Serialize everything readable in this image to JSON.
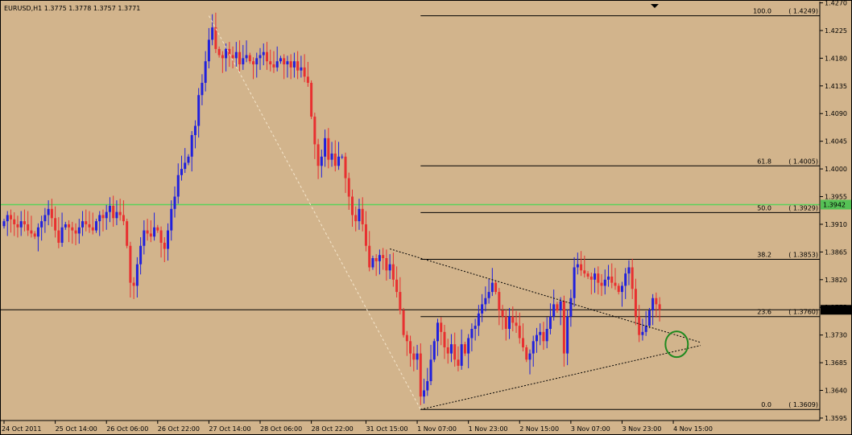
{
  "symbol_header": "EURUSD,H1  1.3775 1.3778 1.3757 1.3771",
  "colors": {
    "background": "#d2b48c",
    "bull": "#2020dd",
    "bear": "#e83030",
    "horizontal_line": "#5ad25a",
    "axis": "#000000",
    "circle": "#1f8a1f",
    "price_tag": "#000000",
    "green_tag": "#55c155"
  },
  "chart_data": {
    "type": "candlestick",
    "instrument": "EURUSD",
    "timeframe": "H1",
    "ohlc_last": {
      "open": 1.3775,
      "high": 1.3778,
      "low": 1.3757,
      "close": 1.3771
    },
    "ylim": [
      1.3591,
      1.4272
    ],
    "y_ticks": [
      "1.4270",
      "1.4225",
      "1.4180",
      "1.4135",
      "1.4090",
      "1.4045",
      "1.4000",
      "1.3955",
      "1.3910",
      "1.3865",
      "1.3820",
      "1.3775",
      "1.3730",
      "1.3685",
      "1.3640",
      "1.3595"
    ],
    "x_labels": [
      "24 Oct 2011",
      "25 Oct 14:00",
      "26 Oct 06:00",
      "26 Oct 22:00",
      "27 Oct 14:00",
      "28 Oct 06:00",
      "28 Oct 22:00",
      "31 Oct 15:00",
      "1 Nov 07:00",
      "1 Nov 23:00",
      "2 Nov 15:00",
      "3 Nov 07:00",
      "3 Nov 23:00",
      "4 Nov 15:00"
    ],
    "x_label_index": [
      0,
      15,
      30,
      45,
      60,
      75,
      90,
      106,
      121,
      136,
      151,
      166,
      181,
      196
    ],
    "bar_count": 205,
    "closes": [
      1.3915,
      1.3925,
      1.3918,
      1.391,
      1.3905,
      1.3915,
      1.391,
      1.39,
      1.3895,
      1.389,
      1.3905,
      1.3915,
      1.3925,
      1.3935,
      1.392,
      1.39,
      1.388,
      1.3905,
      1.391,
      1.3905,
      1.39,
      1.3895,
      1.3905,
      1.3915,
      1.391,
      1.3905,
      1.39,
      1.3915,
      1.3925,
      1.392,
      1.393,
      1.394,
      1.392,
      1.393,
      1.3925,
      1.3915,
      1.3875,
      1.3815,
      1.381,
      1.3845,
      1.3875,
      1.39,
      1.3895,
      1.389,
      1.3905,
      1.39,
      1.388,
      1.387,
      1.39,
      1.3935,
      1.3955,
      1.399,
      1.4,
      1.401,
      1.402,
      1.4055,
      1.407,
      1.412,
      1.414,
      1.4175,
      1.421,
      1.423,
      1.4195,
      1.4185,
      1.418,
      1.4195,
      1.4185,
      1.418,
      1.419,
      1.417,
      1.418,
      1.4185,
      1.4175,
      1.417,
      1.418,
      1.4185,
      1.419,
      1.4175,
      1.417,
      1.4165,
      1.4175,
      1.418,
      1.417,
      1.4175,
      1.4165,
      1.4175,
      1.416,
      1.4165,
      1.415,
      1.414,
      1.4085,
      1.404,
      1.4005,
      1.402,
      1.405,
      1.4015,
      1.4025,
      1.4005,
      1.402,
      1.402,
      1.3985,
      1.3955,
      1.3925,
      1.3915,
      1.3935,
      1.391,
      1.3875,
      1.384,
      1.3855,
      1.385,
      1.386,
      1.3855,
      1.3835,
      1.3845,
      1.382,
      1.38,
      1.377,
      1.373,
      1.372,
      1.37,
      1.369,
      1.37,
      1.363,
      1.364,
      1.3655,
      1.369,
      1.372,
      1.375,
      1.3735,
      1.371,
      1.37,
      1.3715,
      1.369,
      1.368,
      1.3715,
      1.37,
      1.3725,
      1.374,
      1.3745,
      1.3765,
      1.378,
      1.379,
      1.38,
      1.3815,
      1.38,
      1.377,
      1.376,
      1.374,
      1.376,
      1.375,
      1.3745,
      1.3725,
      1.371,
      1.369,
      1.37,
      1.372,
      1.373,
      1.3735,
      1.372,
      1.374,
      1.376,
      1.378,
      1.377,
      1.3785,
      1.37,
      1.376,
      1.379,
      1.384,
      1.3845,
      1.3835,
      1.383,
      1.3825,
      1.382,
      1.383,
      1.3815,
      1.381,
      1.382,
      1.3825,
      1.3815,
      1.381,
      1.38,
      1.381,
      1.383,
      1.384,
      1.3805,
      1.376,
      1.373,
      1.3735,
      1.3745,
      1.377,
      1.379,
      1.378,
      1.3771
    ],
    "levels": [
      {
        "label": "100.0",
        "price_text": "( 1.4249)",
        "price": 1.4249
      },
      {
        "label": "61.8",
        "price_text": "( 1.4005)",
        "price": 1.4005
      },
      {
        "label": "50.0",
        "price_text": "( 1.3929)",
        "price": 1.3929
      },
      {
        "label": "38.2",
        "price_text": "( 1.3853)",
        "price": 1.3853
      },
      {
        "label": "23.6",
        "price_text": "( 1.3760)",
        "price": 1.376
      },
      {
        "label": "0.0",
        "price_text": "( 1.3609)",
        "price": 1.3609
      }
    ],
    "fib_start_index": 60,
    "fib_end_index": 122,
    "green_line_price": 1.3942,
    "green_price_tag": "1.3942",
    "current_price_line": 1.3771,
    "current_price_tag": "1.3771",
    "triangle": {
      "upper": {
        "from_index": 113,
        "from_price": 1.387,
        "to_index": 204,
        "to_price": 1.3718
      },
      "lower": {
        "from_index": 122,
        "from_price": 1.3609,
        "to_index": 204,
        "to_price": 1.3713
      }
    },
    "circle_index": 197,
    "circle_price": 1.3715
  }
}
